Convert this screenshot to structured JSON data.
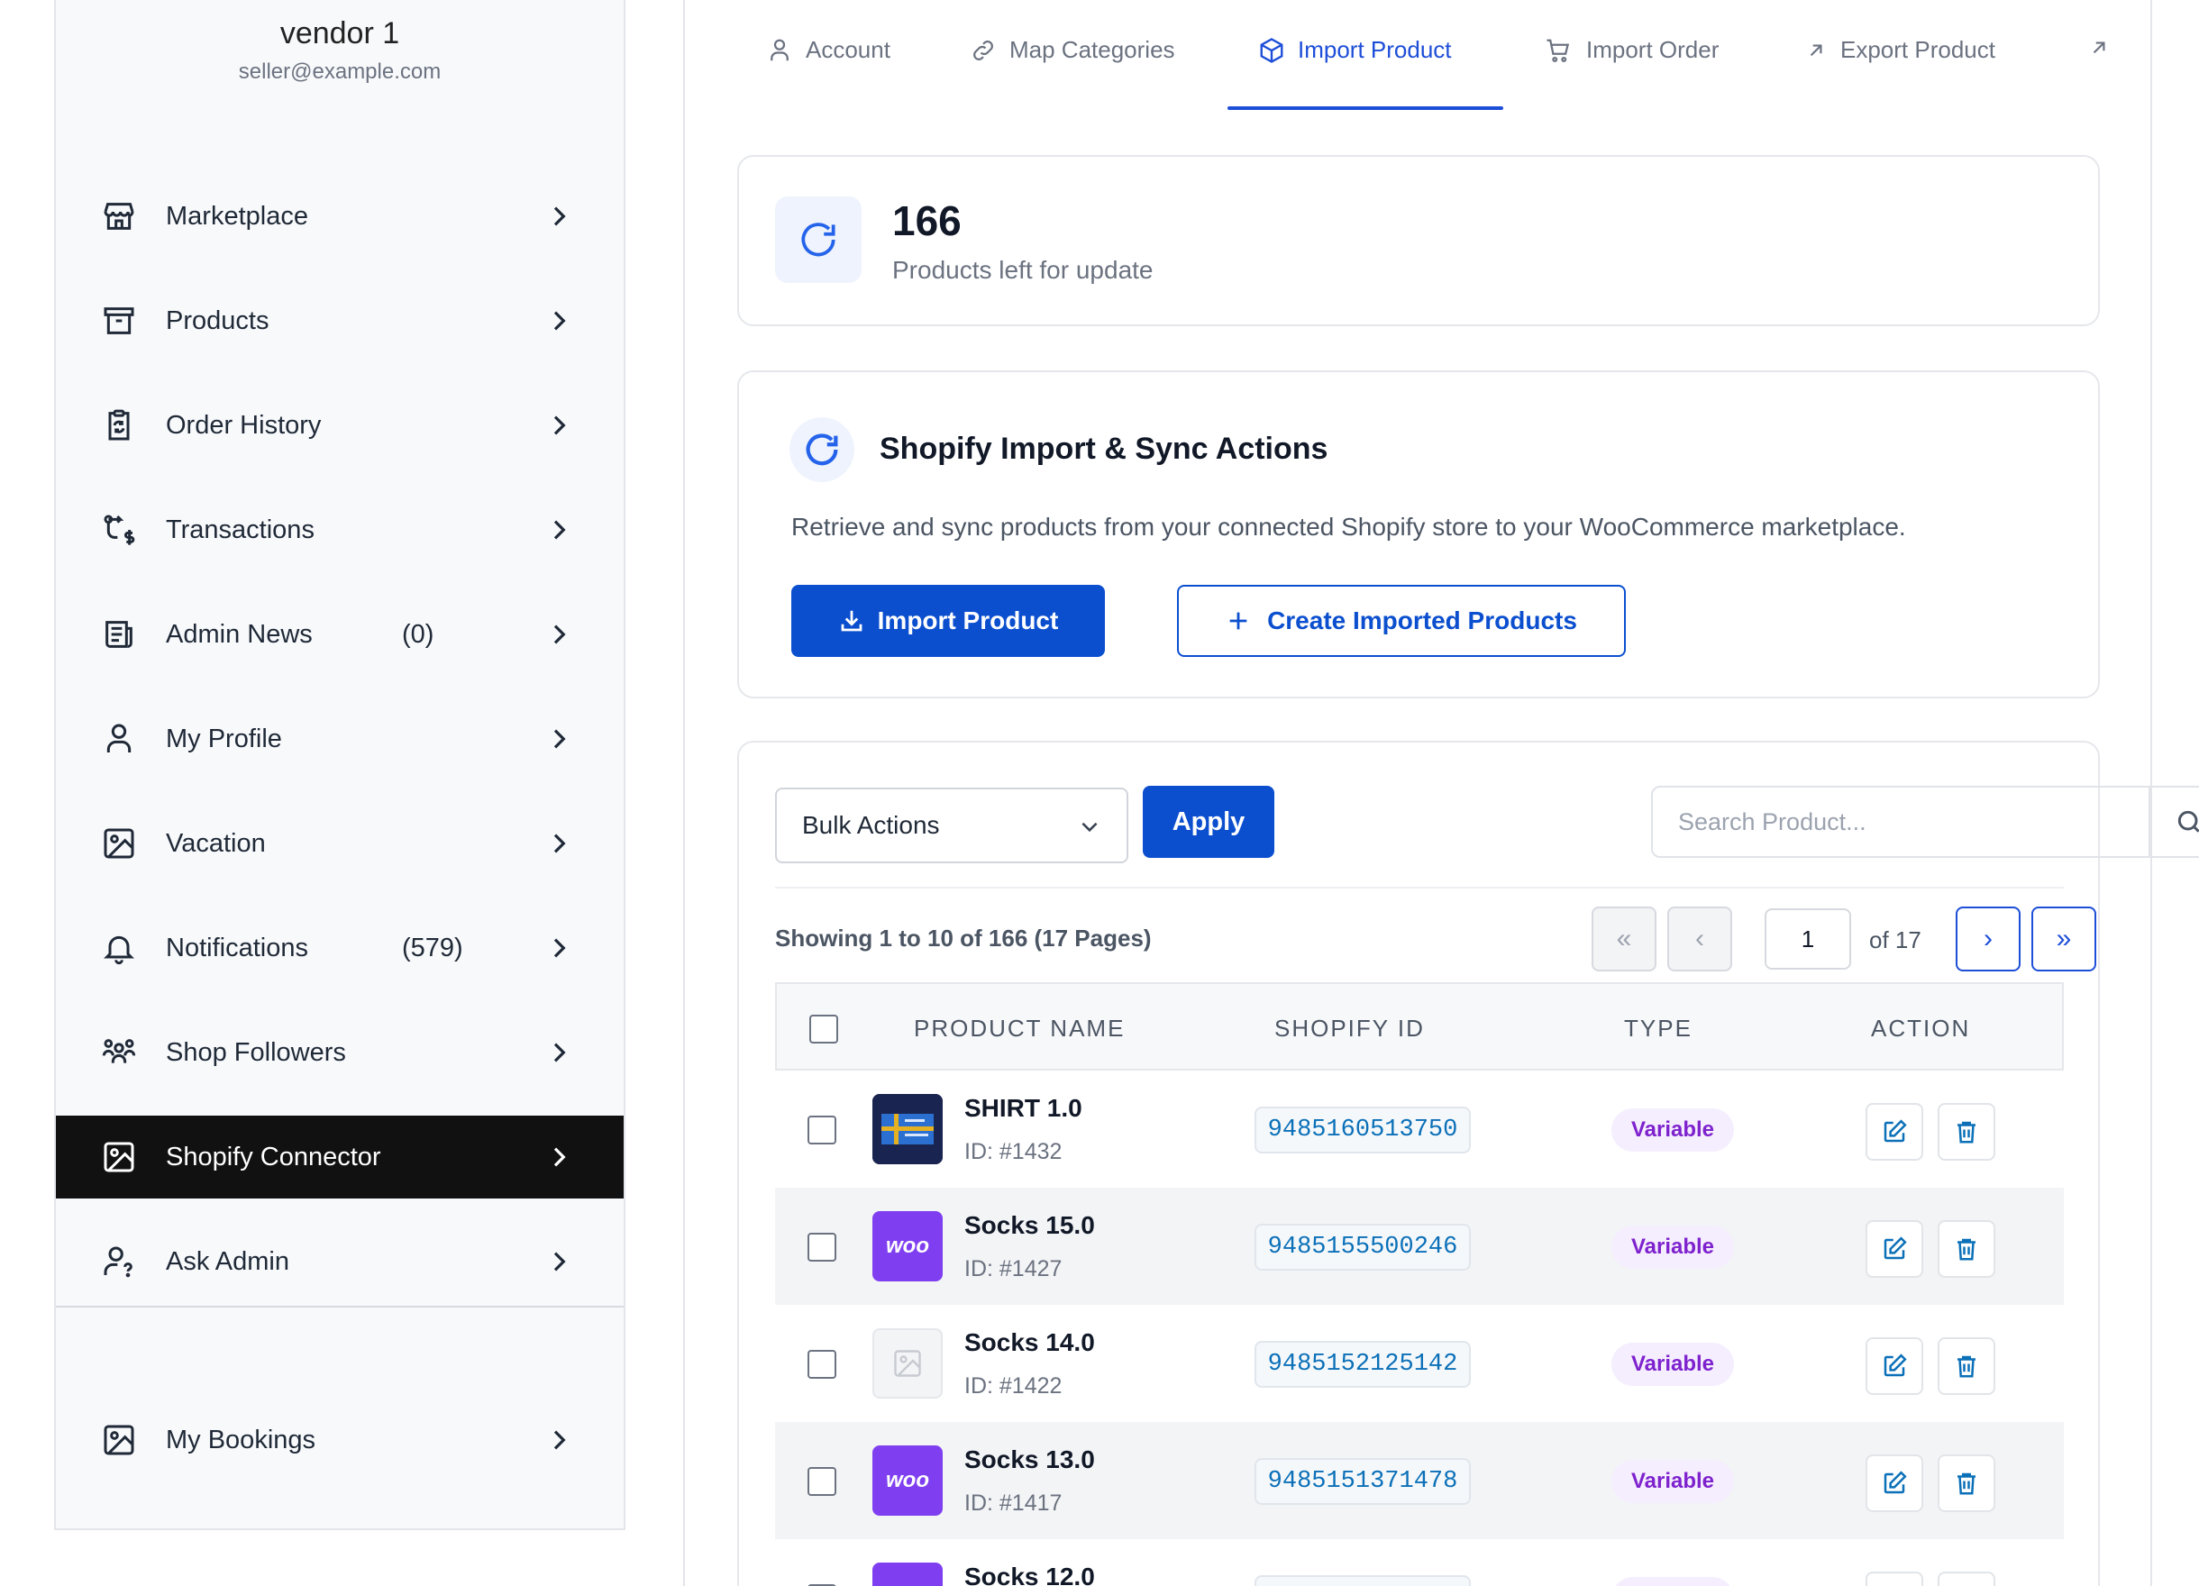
{
  "vendor": {
    "name": "vendor 1",
    "email": "seller@example.com"
  },
  "sidebar": {
    "items": [
      {
        "label": "Marketplace",
        "icon": "store-icon"
      },
      {
        "label": "Products",
        "icon": "archive-box-icon"
      },
      {
        "label": "Order History",
        "icon": "clipboard-sync-icon"
      },
      {
        "label": "Transactions",
        "icon": "transaction-dollar-icon"
      },
      {
        "label": "Admin News",
        "count": "(0)",
        "icon": "newspaper-icon"
      },
      {
        "label": "My Profile",
        "icon": "user-icon"
      },
      {
        "label": "Vacation",
        "icon": "image-icon"
      },
      {
        "label": "Notifications",
        "count": "(579)",
        "icon": "bell-icon"
      },
      {
        "label": "Shop Followers",
        "icon": "users-group-icon"
      },
      {
        "label": "Shopify Connector",
        "icon": "image-icon",
        "active": true
      },
      {
        "label": "Ask Admin",
        "icon": "user-question-icon"
      },
      {
        "label": "My Bookings",
        "icon": "image-icon"
      }
    ]
  },
  "tabs": [
    {
      "label": "Account",
      "icon": "user-icon"
    },
    {
      "label": "Map Categories",
      "icon": "link-icon"
    },
    {
      "label": "Import Product",
      "icon": "cube-icon",
      "active": true
    },
    {
      "label": "Import Order",
      "icon": "cart-icon"
    },
    {
      "label": "Export Product",
      "icon": "arrow-up-right-icon"
    }
  ],
  "stats": {
    "value": "166",
    "label": "Products left for update"
  },
  "sync": {
    "title": "Shopify Import & Sync Actions",
    "description": "Retrieve and sync products from your connected Shopify store to your WooCommerce marketplace.",
    "import_button": "Import Product",
    "create_button": "Create Imported Products"
  },
  "toolbar": {
    "bulk_actions": "Bulk Actions",
    "apply": "Apply",
    "search_placeholder": "Search Product..."
  },
  "pagination": {
    "showing": "Showing 1 to 10 of 166 (17 Pages)",
    "first": "«",
    "prev": "‹",
    "current": "1",
    "of": "of 17",
    "next": "›",
    "last": "»"
  },
  "table": {
    "headers": {
      "name": "PRODUCT NAME",
      "shopify_id": "SHOPIFY ID",
      "type": "TYPE",
      "action": "ACTION"
    },
    "rows": [
      {
        "name": "SHIRT 1.0",
        "id": "ID: #1432",
        "shopify_id": "9485160513750",
        "type": "Variable",
        "thumb": "shirt"
      },
      {
        "name": "Socks 15.0",
        "id": "ID: #1427",
        "shopify_id": "9485155500246",
        "type": "Variable",
        "thumb": "woo"
      },
      {
        "name": "Socks 14.0",
        "id": "ID: #1422",
        "shopify_id": "9485152125142",
        "type": "Variable",
        "thumb": "placeholder"
      },
      {
        "name": "Socks 13.0",
        "id": "ID: #1417",
        "shopify_id": "9485151371478",
        "type": "Variable",
        "thumb": "woo"
      },
      {
        "name": "Socks 12.0",
        "id": "",
        "shopify_id": "",
        "type": "",
        "thumb": "woo"
      }
    ],
    "woo_logo_text": "woo"
  },
  "colors": {
    "accent": "#1d4ed8",
    "primary_button": "#0b4fcf",
    "active_sidebar": "#111111",
    "badge_text": "#7e22ce",
    "id_text": "#0b70b8"
  }
}
